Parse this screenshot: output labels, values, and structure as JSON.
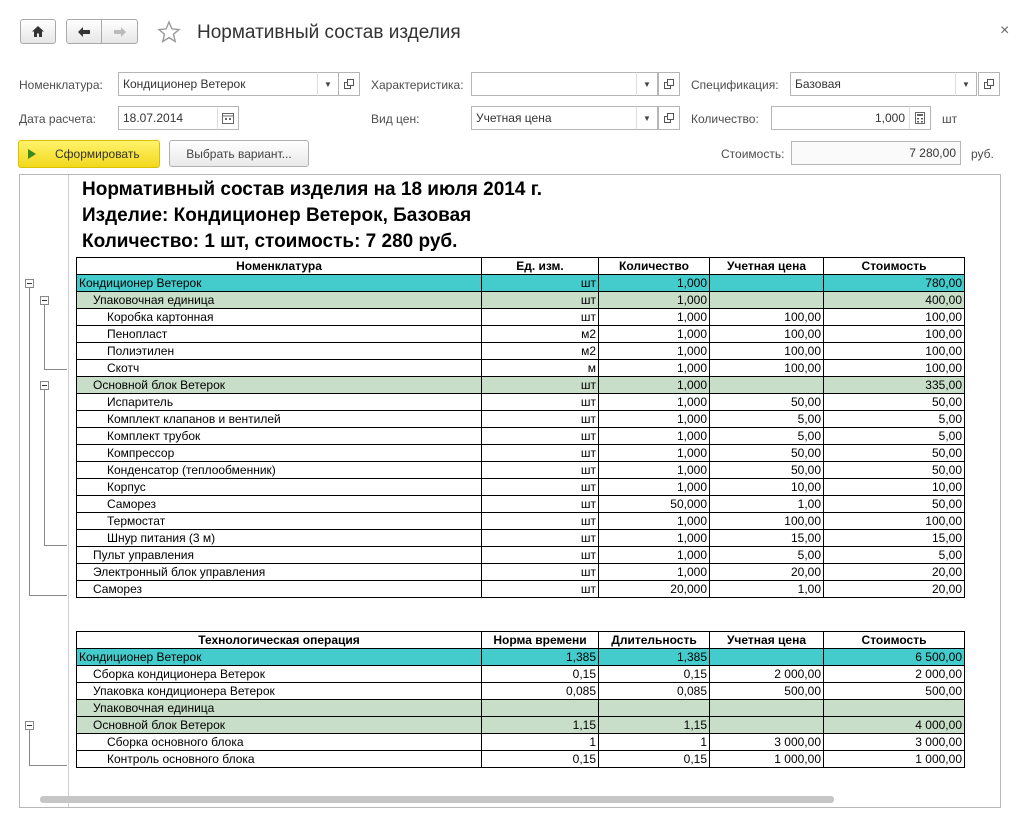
{
  "window": {
    "title": "Нормативный состав изделия"
  },
  "form": {
    "nomenclature_label": "Номенклатура:",
    "nomenclature_value": "Кондиционер Ветерок",
    "characteristic_label": "Характеристика:",
    "characteristic_value": "",
    "specification_label": "Спецификация:",
    "specification_value": "Базовая",
    "date_label": "Дата расчета:",
    "date_value": "18.07.2014",
    "price_type_label": "Вид цен:",
    "price_type_value": "Учетная цена",
    "quantity_label": "Количество:",
    "quantity_value": "1,000",
    "quantity_unit": "шт",
    "form_button": "Сформировать",
    "variant_button": "Выбрать вариант...",
    "cost_label": "Стоимость:",
    "cost_value": "7 280,00",
    "cost_unit": "руб."
  },
  "report": {
    "heading1": "Нормативный состав изделия на 18 июля 2014 г.",
    "heading2": "Изделие: Кондиционер Ветерок, Базовая",
    "heading3": "Количество: 1 шт, стоимость: 7 280 руб.",
    "materials": {
      "headers": [
        "Номенклатура",
        "Ед. изм.",
        "Количество",
        "Учетная цена",
        "Стоимость"
      ],
      "rows": [
        {
          "lvl": 0,
          "name": "Кондиционер Ветерок",
          "unit": "шт",
          "qty": "1,000",
          "price": "",
          "cost": "780,00"
        },
        {
          "lvl": 1,
          "name": "Упаковочная единица",
          "unit": "шт",
          "qty": "1,000",
          "price": "",
          "cost": "400,00"
        },
        {
          "lvl": 2,
          "name": "Коробка картонная",
          "unit": "шт",
          "qty": "1,000",
          "price": "100,00",
          "cost": "100,00"
        },
        {
          "lvl": 2,
          "name": "Пенопласт",
          "unit": "м2",
          "qty": "1,000",
          "price": "100,00",
          "cost": "100,00"
        },
        {
          "lvl": 2,
          "name": "Полиэтилен",
          "unit": "м2",
          "qty": "1,000",
          "price": "100,00",
          "cost": "100,00"
        },
        {
          "lvl": 2,
          "name": "Скотч",
          "unit": "м",
          "qty": "1,000",
          "price": "100,00",
          "cost": "100,00"
        },
        {
          "lvl": 1,
          "name": "Основной блок Ветерок",
          "unit": "шт",
          "qty": "1,000",
          "price": "",
          "cost": "335,00"
        },
        {
          "lvl": 2,
          "name": "Испаритель",
          "unit": "шт",
          "qty": "1,000",
          "price": "50,00",
          "cost": "50,00"
        },
        {
          "lvl": 2,
          "name": "Комплект клапанов и вентилей",
          "unit": "шт",
          "qty": "1,000",
          "price": "5,00",
          "cost": "5,00"
        },
        {
          "lvl": 2,
          "name": "Комплект трубок",
          "unit": "шт",
          "qty": "1,000",
          "price": "5,00",
          "cost": "5,00"
        },
        {
          "lvl": 2,
          "name": "Компрессор",
          "unit": "шт",
          "qty": "1,000",
          "price": "50,00",
          "cost": "50,00"
        },
        {
          "lvl": 2,
          "name": "Конденсатор (теплообменник)",
          "unit": "шт",
          "qty": "1,000",
          "price": "50,00",
          "cost": "50,00"
        },
        {
          "lvl": 2,
          "name": "Корпус",
          "unit": "шт",
          "qty": "1,000",
          "price": "10,00",
          "cost": "10,00"
        },
        {
          "lvl": 2,
          "name": "Саморез",
          "unit": "шт",
          "qty": "50,000",
          "price": "1,00",
          "cost": "50,00"
        },
        {
          "lvl": 2,
          "name": "Термостат",
          "unit": "шт",
          "qty": "1,000",
          "price": "100,00",
          "cost": "100,00"
        },
        {
          "lvl": 2,
          "name": "Шнур питания (3 м)",
          "unit": "шт",
          "qty": "1,000",
          "price": "15,00",
          "cost": "15,00"
        },
        {
          "lvl": 3,
          "name": "Пульт управления",
          "unit": "шт",
          "qty": "1,000",
          "price": "5,00",
          "cost": "5,00"
        },
        {
          "lvl": 3,
          "name": "Электронный блок управления",
          "unit": "шт",
          "qty": "1,000",
          "price": "20,00",
          "cost": "20,00"
        },
        {
          "lvl": 3,
          "name": "Саморез",
          "unit": "шт",
          "qty": "20,000",
          "price": "1,00",
          "cost": "20,00"
        }
      ]
    },
    "operations": {
      "headers": [
        "Технологическая операция",
        "Норма времени",
        "Длительность",
        "Учетная цена",
        "Стоимость"
      ],
      "rows": [
        {
          "lvl": 0,
          "name": "Кондиционер Ветерок",
          "norm": "1,385",
          "dur": "1,385",
          "price": "",
          "cost": "6 500,00"
        },
        {
          "lvl": 3,
          "name": "Сборка кондиционера Ветерок",
          "norm": "0,15",
          "dur": "0,15",
          "price": "2 000,00",
          "cost": "2 000,00"
        },
        {
          "lvl": 3,
          "name": "Упаковка кондиционера Ветерок",
          "norm": "0,085",
          "dur": "0,085",
          "price": "500,00",
          "cost": "500,00"
        },
        {
          "lvl": 1,
          "name": "Упаковочная единица",
          "norm": "",
          "dur": "",
          "price": "",
          "cost": ""
        },
        {
          "lvl": 1,
          "name": "Основной блок Ветерок",
          "norm": "1,15",
          "dur": "1,15",
          "price": "",
          "cost": "4 000,00"
        },
        {
          "lvl": 2,
          "name": "Сборка основного блока",
          "norm": "1",
          "dur": "1",
          "price": "3 000,00",
          "cost": "3 000,00"
        },
        {
          "lvl": 2,
          "name": "Контроль основного блока",
          "norm": "0,15",
          "dur": "0,15",
          "price": "1 000,00",
          "cost": "1 000,00"
        }
      ]
    }
  }
}
